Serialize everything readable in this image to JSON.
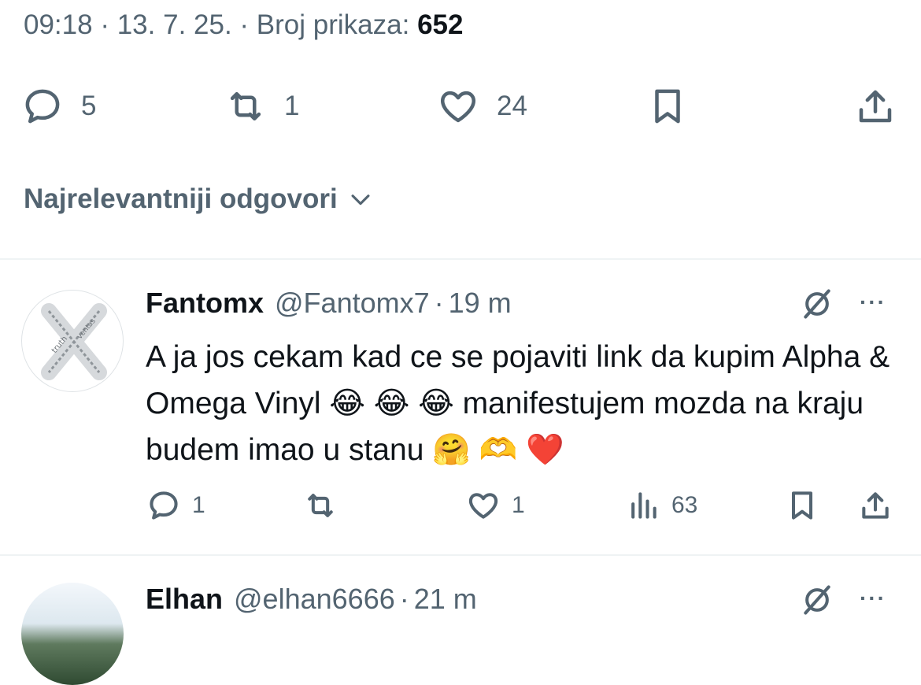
{
  "tweet_meta": {
    "time": "09:18",
    "date": "13. 7. 25.",
    "views_label": "Broj prikaza:",
    "views_count": "652"
  },
  "tweet_actions": {
    "replies": "5",
    "reposts": "1",
    "likes": "24"
  },
  "sort": {
    "label": "Najrelevantniji odgovori"
  },
  "replies": [
    {
      "name": "Fantomx",
      "handle": "@Fantomx7",
      "age": "19 m",
      "text": "A ja jos cekam kad ce se pojaviti link da kupim Alpha & Omega Vinyl 😂 😂 😂 manifestujem mozda na kraju budem imao u stanu 🤗 🫶 ❤️",
      "replies": "1",
      "reposts": "",
      "likes": "1",
      "views": "63",
      "avatar_text": [
        "truth",
        "ventas"
      ]
    },
    {
      "name": "Elhan",
      "handle": "@elhan6666",
      "age": "21 m"
    }
  ],
  "separator": "·",
  "more_glyph": "···",
  "colors": {
    "text": "#0f1419",
    "secondary": "#536471",
    "divider": "#eff3f4"
  },
  "icons": [
    "reply-icon",
    "repost-icon",
    "like-icon",
    "bookmark-icon",
    "share-icon",
    "grok-icon",
    "more-icon",
    "views-icon",
    "chevron-down-icon"
  ]
}
